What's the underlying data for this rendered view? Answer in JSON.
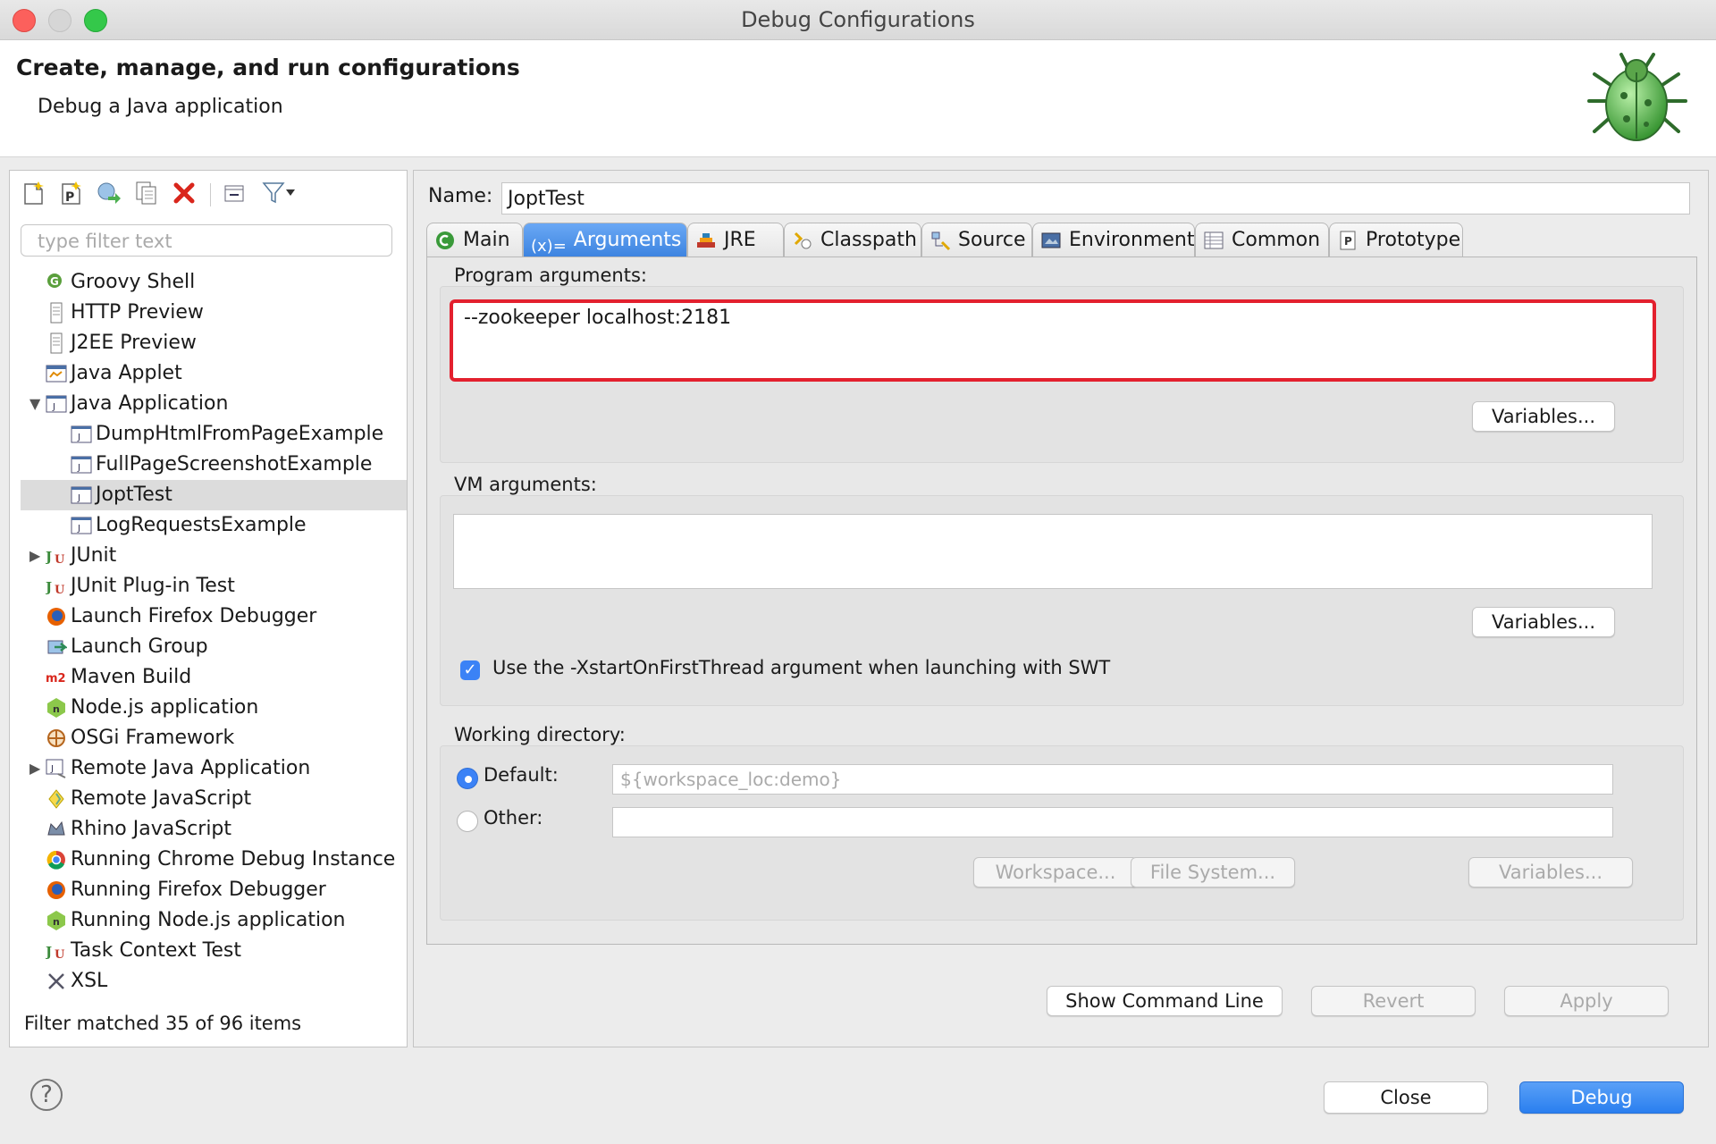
{
  "window": {
    "title": "Debug Configurations"
  },
  "header": {
    "title": "Create, manage, and run configurations",
    "subtitle": "Debug a Java application"
  },
  "left": {
    "toolbar": [
      "new-config-icon",
      "new-prototype-icon",
      "export-icon",
      "duplicate-icon",
      "delete-icon",
      "collapse-all-icon",
      "filter-icon",
      "dropdown-icon"
    ],
    "filter_placeholder": "type filter text",
    "tree": [
      {
        "label": "Groovy Shell",
        "icon": "groovy-icon",
        "level": 0
      },
      {
        "label": "HTTP Preview",
        "icon": "page-icon",
        "level": 0
      },
      {
        "label": "J2EE Preview",
        "icon": "page-icon",
        "level": 0
      },
      {
        "label": "Java Applet",
        "icon": "applet-icon",
        "level": 0
      },
      {
        "label": "Java Application",
        "icon": "java-app-icon",
        "level": 0,
        "expanded": true
      },
      {
        "label": "DumpHtmlFromPageExample",
        "icon": "java-app-icon",
        "level": 1
      },
      {
        "label": "FullPageScreenshotExample",
        "icon": "java-app-icon",
        "level": 1
      },
      {
        "label": "JoptTest",
        "icon": "java-app-icon",
        "level": 1,
        "selected": true
      },
      {
        "label": "LogRequestsExample",
        "icon": "java-app-icon",
        "level": 1
      },
      {
        "label": "JUnit",
        "icon": "junit-icon",
        "level": 0,
        "collapsed": true
      },
      {
        "label": "JUnit Plug-in Test",
        "icon": "junit-icon",
        "level": 0
      },
      {
        "label": "Launch Firefox Debugger",
        "icon": "firefox-icon",
        "level": 0
      },
      {
        "label": "Launch Group",
        "icon": "launch-group-icon",
        "level": 0
      },
      {
        "label": "Maven Build",
        "icon": "maven-icon",
        "level": 0
      },
      {
        "label": "Node.js application",
        "icon": "nodejs-icon",
        "level": 0
      },
      {
        "label": "OSGi Framework",
        "icon": "osgi-icon",
        "level": 0
      },
      {
        "label": "Remote Java Application",
        "icon": "remote-java-icon",
        "level": 0,
        "collapsed": true
      },
      {
        "label": "Remote JavaScript",
        "icon": "remote-js-icon",
        "level": 0
      },
      {
        "label": "Rhino JavaScript",
        "icon": "rhino-icon",
        "level": 0
      },
      {
        "label": "Running Chrome Debug Instance",
        "icon": "chrome-icon",
        "level": 0
      },
      {
        "label": "Running Firefox Debugger",
        "icon": "firefox-icon",
        "level": 0
      },
      {
        "label": "Running Node.js application",
        "icon": "nodejs-icon",
        "level": 0
      },
      {
        "label": "Task Context Test",
        "icon": "junit-icon",
        "level": 0
      },
      {
        "label": "XSL",
        "icon": "xsl-icon",
        "level": 0
      }
    ],
    "status": "Filter matched 35 of 96 items"
  },
  "right": {
    "name_label": "Name:",
    "name_value": "JoptTest",
    "tabs": [
      {
        "label": "Main",
        "icon": "main-tab-icon"
      },
      {
        "label": "Arguments",
        "icon": "arguments-tab-icon",
        "active": true
      },
      {
        "label": "JRE",
        "icon": "jre-tab-icon"
      },
      {
        "label": "Classpath",
        "icon": "classpath-tab-icon"
      },
      {
        "label": "Source",
        "icon": "source-tab-icon"
      },
      {
        "label": "Environment",
        "icon": "environment-tab-icon"
      },
      {
        "label": "Common",
        "icon": "common-tab-icon"
      },
      {
        "label": "Prototype",
        "icon": "prototype-tab-icon"
      }
    ],
    "arguments_tab_prefix": "(x)=",
    "program_args_label": "Program arguments:",
    "program_args_value": "--zookeeper localhost:2181",
    "variables_label": "Variables...",
    "vm_args_label": "VM arguments:",
    "vm_args_value": "",
    "xstart_label": "Use the -XstartOnFirstThread argument when launching with SWT",
    "xstart_checked": true,
    "workdir_label": "Working directory:",
    "default_label": "Default:",
    "default_value": "${workspace_loc:demo}",
    "other_label": "Other:",
    "other_value": "",
    "workspace_btn": "Workspace...",
    "filesystem_btn": "File System...",
    "show_cmd": "Show Command Line",
    "revert": "Revert",
    "apply": "Apply"
  },
  "footer": {
    "help": "?",
    "close": "Close",
    "debug": "Debug"
  },
  "colors": {
    "accent": "#3b82f6",
    "highlight_border": "#e3202e",
    "selection": "#dcdcdc"
  }
}
